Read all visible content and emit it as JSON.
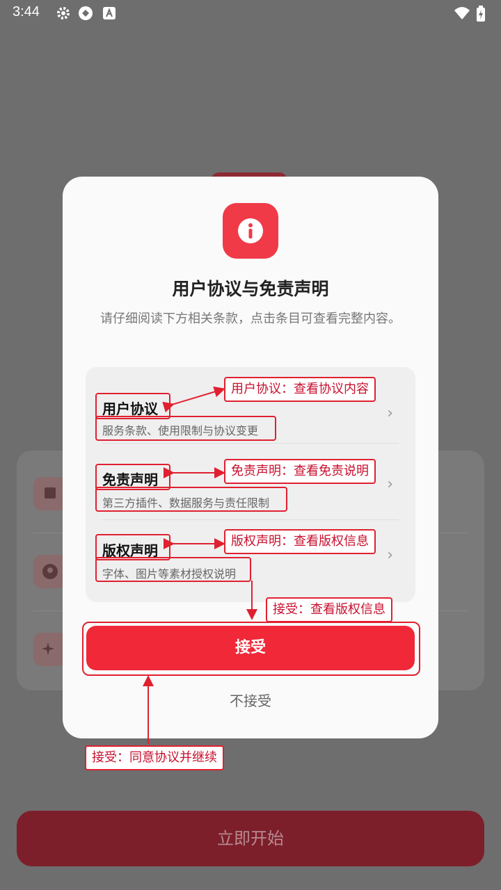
{
  "status_bar": {
    "time": "3:44"
  },
  "background": {
    "start_label": "立即开始"
  },
  "dialog": {
    "title": "用户协议与免责声明",
    "description": "请仔细阅读下方相关条款，点击条目可查看完整内容。",
    "items": [
      {
        "label": "用户协议",
        "sub": "服务条款、使用限制与协议变更",
        "chevron": "›"
      },
      {
        "label": "免责声明",
        "sub": "第三方插件、数据服务与责任限制",
        "chevron": "›"
      },
      {
        "label": "版权声明",
        "sub": "字体、图片等素材授权说明",
        "chevron": "›"
      }
    ],
    "accept_label": "接受",
    "reject_label": "不接受"
  },
  "annotations": {
    "user_agreement": "用户协议：查看协议内容",
    "disclaimer": "免责声明：查看免责说明",
    "copyright": "版权声明：查看版权信息",
    "accept_info": "接受：查看版权信息",
    "accept_continue": "接受：同意协议并继续"
  },
  "colors": {
    "accent": "#f02838",
    "annotation": "#e02030"
  }
}
